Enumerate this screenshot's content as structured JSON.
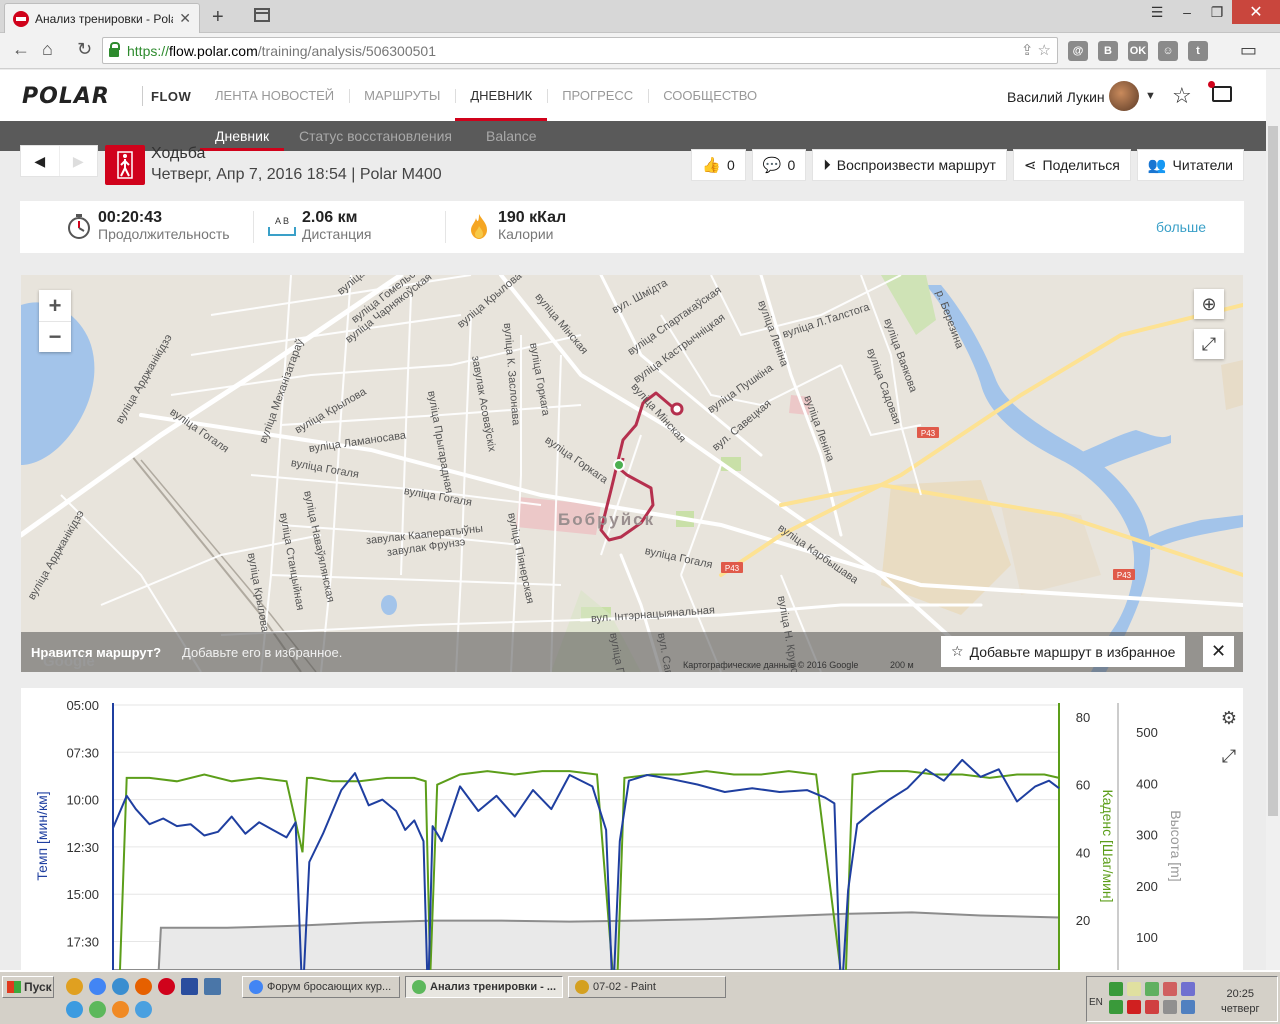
{
  "browser": {
    "tab_title": "Анализ тренировки - Polar F",
    "url_https": "https://",
    "url_host": "flow.polar.com",
    "url_path": "/training/analysis/506300501",
    "ext_labels": [
      "@",
      "B",
      "OK",
      "☺",
      "t"
    ]
  },
  "header": {
    "logo": "POLAR",
    "flow": "FLOW",
    "nav": [
      "ЛЕНТА НОВОСТЕЙ",
      "МАРШРУТЫ",
      "ДНЕВНИК",
      "ПРОГРЕСС",
      "СООБЩЕСТВО"
    ],
    "active_nav": "ДНЕВНИК",
    "username": "Василий Лукин"
  },
  "subnav": [
    "Дневник",
    "Статус восстановления",
    "Balance"
  ],
  "activity": {
    "sport": "Ходьба",
    "date": "Четверг, Апр 7, 2016 18:54 | Polar M400",
    "likes": "0",
    "comments": "0",
    "play_route": "Воспроизвести маршрут",
    "share": "Поделиться",
    "followers": "Читатели"
  },
  "summary": {
    "duration_value": "00:20:43",
    "duration_label": "Продолжительность",
    "distance_value": "2.06 км",
    "distance_label": "Дистанция",
    "distance_ab": "A  B",
    "calories_value": "190 кКал",
    "calories_label": "Калории",
    "more": "больше"
  },
  "map": {
    "city": "Бобруйск",
    "route_badges": [
      "P43",
      "P43",
      "P43"
    ],
    "street_labels": [
      "вуліца Грыбо",
      "вуліца Гомельская",
      "вуліца Чарнякоўская",
      "вуліца Крылова",
      "вуліца Мінская",
      "вул. Шмідта",
      "вуліца Спартакаўская",
      "вуліца Леніна",
      "вуліца Л.Талстога",
      "р. Березина",
      "вуліца Кастрычніцкая",
      "вуліца Ваякова",
      "вуліца Садовая",
      "вуліца Пушкіна",
      "вул. Савецкая",
      "вуліца Леніна",
      "вуліца Мінская",
      "вуліца Горкага",
      "вуліца Гогаля",
      "вуліца Гогаля",
      "вуліца Гогаля",
      "вуліца Гогаля",
      "вуліца Арджанікідзэ",
      "вуліца Механізатараў",
      "вуліца Крылова",
      "вуліца Ламаносава",
      "вуліца Прыгарадная",
      "завулак Асоваўскіх",
      "вуліца К. Заслонава",
      "вуліца Горкага",
      "завулак Кааператыўны",
      "завулак Фрунзэ",
      "вуліца Піянерская",
      "вуліца Наваўялянская",
      "вуліца Станцыйная",
      "вуліца Крылова",
      "вуліца Арджанікідзэ",
      "вуліца Карбышава",
      "вул. Інтэрнацыянальная",
      "вуліца Н. Крупс",
      "вул. Савец",
      "вуліца П"
    ],
    "fav_question": "Нравится маршрут?",
    "fav_hint": "Добавьте его в избранное.",
    "fav_button": "Добавьте маршрут в избранное",
    "google": "Google",
    "attribution": "Картографические данные © 2016 Google",
    "scale": "200 м"
  },
  "chart_data": {
    "type": "line",
    "pace_axis_label": "Темп [мин/км]",
    "cadence_axis_label": "Каденс [Шаг/мин]",
    "altitude_axis_label": "Высота [m]",
    "pace_ticks": [
      "05:00",
      "07:30",
      "10:00",
      "12:30",
      "15:00",
      "17:30"
    ],
    "cadence_ticks": [
      "80",
      "60",
      "40",
      "20"
    ],
    "altitude_ticks": [
      "500",
      "400",
      "300",
      "200",
      "100"
    ],
    "pace_min": [
      5,
      20.7
    ],
    "cadence_range": [
      0,
      85
    ],
    "altitude_range": [
      0,
      520
    ],
    "duration_min": 20.72,
    "pace_series_t": [
      0,
      0.3,
      0.5,
      0.8,
      1.1,
      1.4,
      1.7,
      2.0,
      2.3,
      2.6,
      2.9,
      3.2,
      3.5,
      3.8,
      4.0,
      4.15,
      4.3,
      4.6,
      5.0,
      5.3,
      5.6,
      5.9,
      6.2,
      6.4,
      6.6,
      6.8,
      6.9,
      7.0,
      7.2,
      7.6,
      8.0,
      8.4,
      8.8,
      9.2,
      9.6,
      10.0,
      10.5,
      10.8,
      10.95,
      11.1,
      11.3,
      11.7,
      12.2,
      12.8,
      13.4,
      14.0,
      14.6,
      15.2,
      15.6,
      15.8,
      15.95,
      16.1,
      16.3,
      16.6,
      17.0,
      17.4,
      17.8,
      18.2,
      18.6,
      19.0,
      19.4,
      19.8,
      20.2,
      20.5,
      20.72
    ],
    "pace_series_v": [
      11.5,
      9.8,
      10.5,
      11.3,
      11.0,
      11.4,
      11.3,
      11.9,
      11.7,
      10.9,
      11.8,
      11.2,
      11.6,
      12.0,
      11.2,
      20.7,
      13.3,
      11.8,
      9.5,
      8.6,
      10.3,
      10.0,
      10.6,
      11.6,
      11.1,
      12.2,
      20.7,
      11.4,
      12.2,
      9.3,
      10.6,
      9.8,
      10.9,
      9.5,
      10.5,
      8.7,
      9.3,
      11.6,
      20.7,
      12.2,
      9.0,
      8.7,
      8.9,
      9.2,
      9.6,
      9.4,
      9.6,
      9.5,
      9.9,
      10.2,
      20.7,
      14.8,
      11.3,
      10.7,
      10.0,
      9.4,
      8.4,
      9.0,
      7.9,
      8.8,
      8.4,
      10.1,
      9.3,
      9.0,
      9.4
    ],
    "cadence_series_t": [
      0,
      0.15,
      0.3,
      0.8,
      1.4,
      2.0,
      2.6,
      3.2,
      3.8,
      4.15,
      4.25,
      4.35,
      4.8,
      5.4,
      6.0,
      6.6,
      6.85,
      6.95,
      7.1,
      7.6,
      8.2,
      8.8,
      9.4,
      10.0,
      10.6,
      10.95,
      11.05,
      11.2,
      11.8,
      12.4,
      13.0,
      13.6,
      14.2,
      14.8,
      15.4,
      15.95,
      16.05,
      16.2,
      16.8,
      17.4,
      18.0,
      18.6,
      19.2,
      19.8,
      20.4,
      20.72
    ],
    "cadence_series_v": [
      0,
      0,
      62,
      62,
      61,
      63,
      61,
      62,
      61,
      40,
      62,
      62,
      61,
      61,
      62,
      62,
      61,
      0,
      60,
      63,
      64,
      63,
      64,
      64,
      63,
      0,
      0,
      62,
      63,
      63,
      64,
      63,
      63,
      64,
      63,
      0,
      0,
      63,
      64,
      64,
      63,
      63,
      62,
      63,
      63,
      62
    ],
    "altitude_series_t": [
      0,
      1.0,
      1.05,
      2.5,
      4.0,
      5.5,
      7.0,
      8.5,
      10.0,
      11.5,
      13.0,
      14.5,
      16.0,
      17.5,
      19.0,
      20.72
    ],
    "altitude_series_v": [
      0,
      0,
      118,
      118,
      122,
      128,
      132,
      132,
      130,
      132,
      135,
      140,
      145,
      148,
      142,
      138
    ]
  }
}
